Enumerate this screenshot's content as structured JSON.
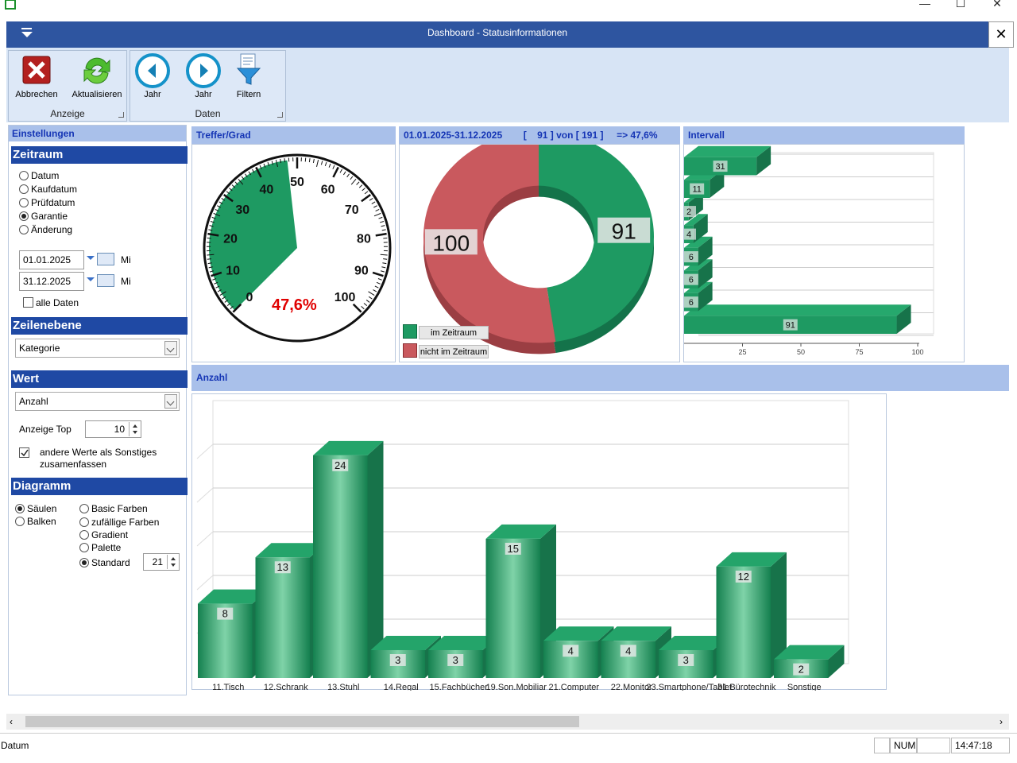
{
  "window": {
    "title": "Dashboard - Statusinformationen"
  },
  "ribbon": {
    "groups": [
      {
        "label": "Anzeige"
      },
      {
        "label": "Daten"
      }
    ],
    "buttons": {
      "abbrechen": "Abbrechen",
      "aktualisieren": "Aktualisieren",
      "jahr_back": "Jahr",
      "jahr_fwd": "Jahr",
      "filtern": "Filtern"
    }
  },
  "settings": {
    "header": "Einstellungen",
    "zeitraum": {
      "title": "Zeitraum",
      "options": [
        "Datum",
        "Kaufdatum",
        "Prüfdatum",
        "Garantie",
        "Änderung"
      ],
      "selected": "Garantie",
      "from": "01.01.2025",
      "to": "31.12.2025",
      "from_day": "Mi",
      "to_day": "Mi",
      "all_label": "alle Daten"
    },
    "zeilenebene": {
      "title": "Zeilenebene",
      "value": "Kategorie"
    },
    "wert": {
      "title": "Wert",
      "value": "Anzahl",
      "top_label": "Anzeige Top",
      "top_value": "10",
      "others_label": "andere Werte als Sonstiges zusamenfassen"
    },
    "diagramm": {
      "title": "Diagramm",
      "types": [
        "Säulen",
        "Balken"
      ],
      "type_selected": "Säulen",
      "colors": [
        "Basic Farben",
        "zufällige Farben",
        "Gradient",
        "Palette",
        "Standard"
      ],
      "color_selected": "Standard",
      "standard_value": "21"
    }
  },
  "gauge": {
    "header": "Treffer/Grad",
    "value_label": "47,6%"
  },
  "donut": {
    "header": "01.01.2025-31.12.2025        [    91 ] von [ 191 ]     => 47,6%",
    "legend_in": "im Zeitraum",
    "legend_out": "nicht im Zeitraum"
  },
  "interval": {
    "header": "Intervall"
  },
  "anzahl": {
    "header": "Anzahl"
  },
  "status": {
    "left": "Datum",
    "num": "NUM",
    "time": "14:47:18"
  },
  "colors": {
    "green": "#1e9a62",
    "red": "#c9595e",
    "accent": "#2e55a0"
  },
  "chart_data": [
    {
      "type": "gauge",
      "value": 47.6,
      "ylim": [
        0,
        100
      ],
      "ticks": [
        "0",
        "10",
        "20",
        "30",
        "40",
        "50",
        "60",
        "70",
        "80",
        "90",
        "100"
      ]
    },
    {
      "type": "pie",
      "categories": [
        "im Zeitraum",
        "nicht im Zeitraum"
      ],
      "values": [
        91,
        100
      ]
    },
    {
      "type": "bar",
      "orientation": "horizontal",
      "values": [
        91,
        6,
        6,
        6,
        4,
        2,
        11,
        31
      ],
      "ticks": [
        "25",
        "50",
        "75",
        "100"
      ],
      "xlim": [
        0,
        100
      ]
    },
    {
      "type": "bar",
      "categories": [
        "11.Tisch",
        "12.Schrank",
        "13.Stuhl",
        "14.Regal",
        "15.Fachbücher",
        "19.Son.Mobiliar",
        "21.Computer",
        "22.Monitor",
        "23.Smartphone/Tablet",
        "31.Bürotechnik",
        "Sonstige"
      ],
      "values": [
        8,
        13,
        24,
        3,
        3,
        15,
        4,
        4,
        3,
        12,
        2
      ],
      "ylim": [
        0,
        27
      ]
    }
  ]
}
